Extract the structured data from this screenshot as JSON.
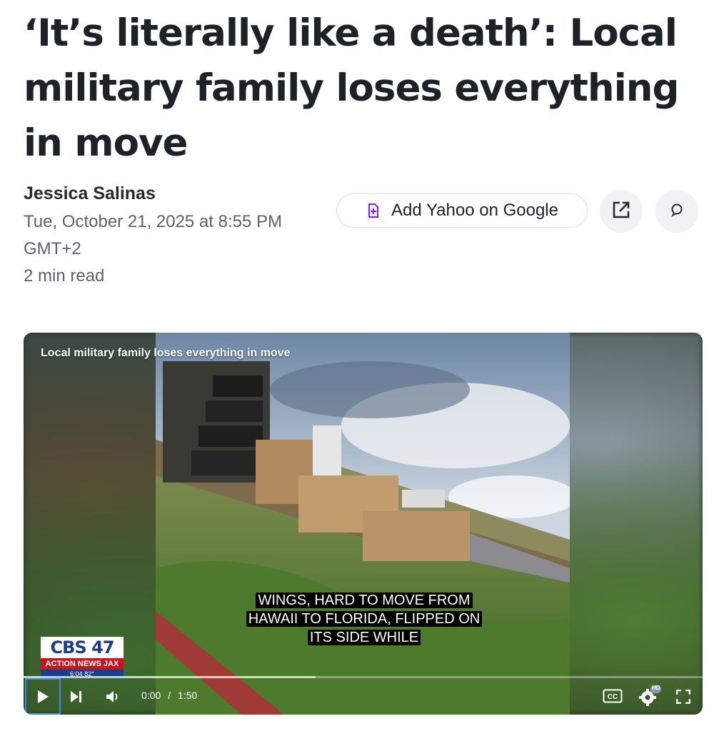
{
  "article": {
    "headline": "‘It’s literally like a death’: Local military family loses everything in move",
    "author": "Jessica Salinas",
    "date_line1": "Tue, October 21, 2025 at 8:55 PM",
    "date_line2": "GMT+2",
    "read_time": "2 min read"
  },
  "actions": {
    "add_google_label": "Add Yahoo on Google",
    "icons": [
      "add-to-google-icon",
      "share-icon",
      "comment-icon"
    ]
  },
  "video": {
    "title": "Local military family loses everything in move",
    "caption": "WINGS, HARD TO MOVE FROM HAWAII TO FLORIDA, FLIPPED ON ITS SIDE WHILE",
    "logo_main": "CBS 47",
    "logo_sub": "ACTION NEWS JAX",
    "logo_ticker": "6:04   82°",
    "current_time": "0:00",
    "time_separator": "/",
    "duration": "1:50",
    "progress_fraction": 0,
    "buffered_fraction": 0.43,
    "hd_badge": "HD",
    "colors": {
      "accent": "#3b8beb",
      "brand_blue": "#1b3e8c",
      "brand_red": "#c4161c"
    }
  }
}
